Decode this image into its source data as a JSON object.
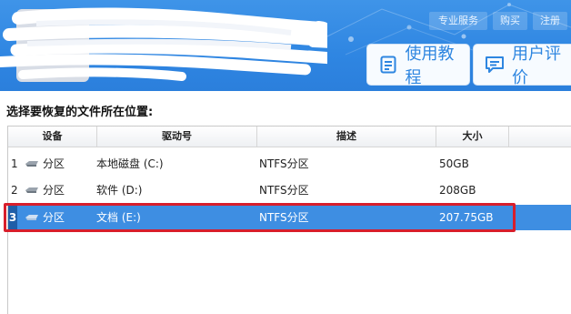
{
  "header": {
    "top_links": [
      "专业服务",
      "购买",
      "注册"
    ],
    "tutorial_button": "使用教程",
    "review_button": "用户评价"
  },
  "section": {
    "title": "选择要恢复的文件所在位置:"
  },
  "table": {
    "columns": [
      "设备",
      "驱动号",
      "描述",
      "大小"
    ],
    "rows": [
      {
        "num": "1",
        "device": "分区",
        "drive": "本地磁盘 (C:)",
        "desc": "NTFS分区",
        "size": "50GB",
        "selected": false
      },
      {
        "num": "2",
        "device": "分区",
        "drive": "软件 (D:)",
        "desc": "NTFS分区",
        "size": "208GB",
        "selected": false
      },
      {
        "num": "3",
        "device": "分区",
        "drive": "文档 (E:)",
        "desc": "NTFS分区",
        "size": "207.75GB",
        "selected": true
      }
    ]
  },
  "colors": {
    "header_blue": "#2f86e2",
    "selection_blue": "#3e8ee2",
    "highlight_red": "#d81e2b"
  }
}
